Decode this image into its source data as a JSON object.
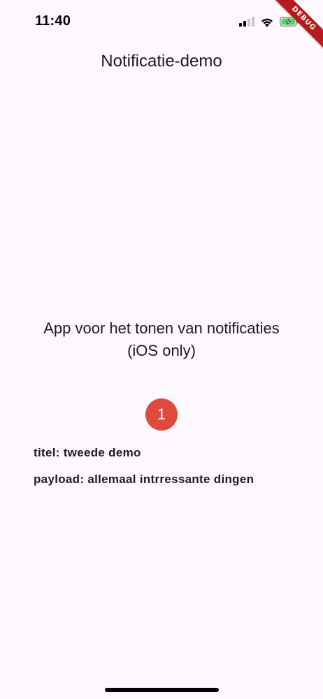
{
  "status_bar": {
    "time": "11:40",
    "signal_icon": "cellular-signal-icon",
    "wifi_icon": "wifi-icon",
    "battery_icon": "battery-charging-icon"
  },
  "debug_banner": {
    "label": "DEBUG",
    "color": "#b71c1c"
  },
  "app_bar": {
    "title": "Notificatie-demo"
  },
  "main": {
    "description_line1": "App voor het tonen van notificaties",
    "description_line2": "(iOS only)",
    "badge_count": "1",
    "badge_color": "#e04a3c",
    "title_line": "titel: tweede demo",
    "payload_line": "payload: allemaal intrressante dingen"
  },
  "colors": {
    "background": "#fdf8fd",
    "text": "#1c1b1f"
  }
}
